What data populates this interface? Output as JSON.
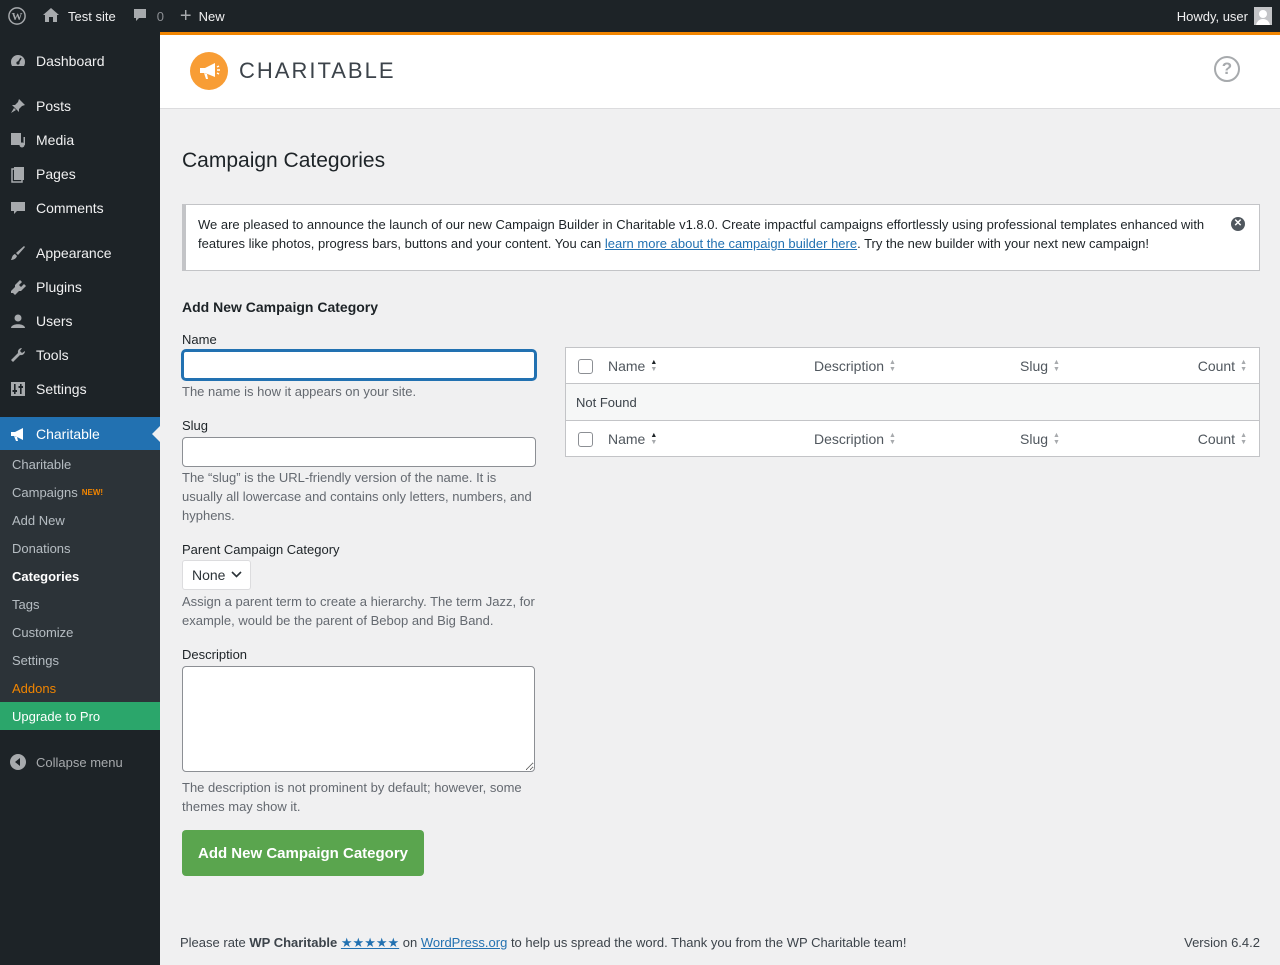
{
  "adminbar": {
    "site_name": "Test site",
    "comments_count": "0",
    "new_label": "New",
    "howdy": "Howdy, user"
  },
  "sidebar": {
    "items": [
      {
        "label": "Dashboard",
        "icon": "dashboard-icon"
      },
      {
        "label": "Posts",
        "icon": "pin-icon"
      },
      {
        "label": "Media",
        "icon": "media-icon"
      },
      {
        "label": "Pages",
        "icon": "pages-icon"
      },
      {
        "label": "Comments",
        "icon": "comment-icon"
      },
      {
        "label": "Appearance",
        "icon": "brush-icon"
      },
      {
        "label": "Plugins",
        "icon": "plug-icon"
      },
      {
        "label": "Users",
        "icon": "user-icon"
      },
      {
        "label": "Tools",
        "icon": "wrench-icon"
      },
      {
        "label": "Settings",
        "icon": "sliders-icon"
      },
      {
        "label": "Charitable",
        "icon": "megaphone-icon"
      }
    ],
    "submenu": [
      {
        "label": "Charitable"
      },
      {
        "label": "Campaigns",
        "badge": "NEW!"
      },
      {
        "label": "Add New"
      },
      {
        "label": "Donations"
      },
      {
        "label": "Categories"
      },
      {
        "label": "Tags"
      },
      {
        "label": "Customize"
      },
      {
        "label": "Settings"
      },
      {
        "label": "Addons"
      },
      {
        "label": "Upgrade to Pro"
      }
    ],
    "collapse_label": "Collapse menu"
  },
  "header": {
    "logo_text": "CHARITABLE",
    "help_symbol": "?"
  },
  "page": {
    "title": "Campaign Categories"
  },
  "notice": {
    "text_before": "We are pleased to announce the launch of our new Campaign Builder in Charitable v1.8.0. Create impactful campaigns effortlessly using professional templates enhanced with features like photos, progress bars, buttons and your content. You can ",
    "link_text": "learn more about the campaign builder here",
    "text_after": ". Try the new builder with your next new campaign!"
  },
  "form": {
    "heading": "Add New Campaign Category",
    "name_label": "Name",
    "name_value": "",
    "name_desc": "The name is how it appears on your site.",
    "slug_label": "Slug",
    "slug_value": "",
    "slug_desc": "The “slug” is the URL-friendly version of the name. It is usually all lowercase and contains only letters, numbers, and hyphens.",
    "parent_label": "Parent Campaign Category",
    "parent_value": "None",
    "parent_desc": "Assign a parent term to create a hierarchy. The term Jazz, for example, would be the parent of Bebop and Big Band.",
    "description_label": "Description",
    "description_value": "",
    "description_desc": "The description is not prominent by default; however, some themes may show it.",
    "submit_label": "Add New Campaign Category"
  },
  "table": {
    "columns": [
      "Name",
      "Description",
      "Slug",
      "Count"
    ],
    "empty_text": "Not Found"
  },
  "footer": {
    "text_before": "Please rate ",
    "plugin_name": "WP Charitable",
    "stars": "★★★★★",
    "text_on": " on ",
    "link": "WordPress.org",
    "text_after": " to help us spread the word. Thank you from the WP Charitable team!",
    "version": "Version 6.4.2"
  },
  "colors": {
    "accent": "#2271b1",
    "brand_orange": "#f18500",
    "submit_green": "#5aa54e",
    "upgrade_green": "#2ba66b"
  }
}
